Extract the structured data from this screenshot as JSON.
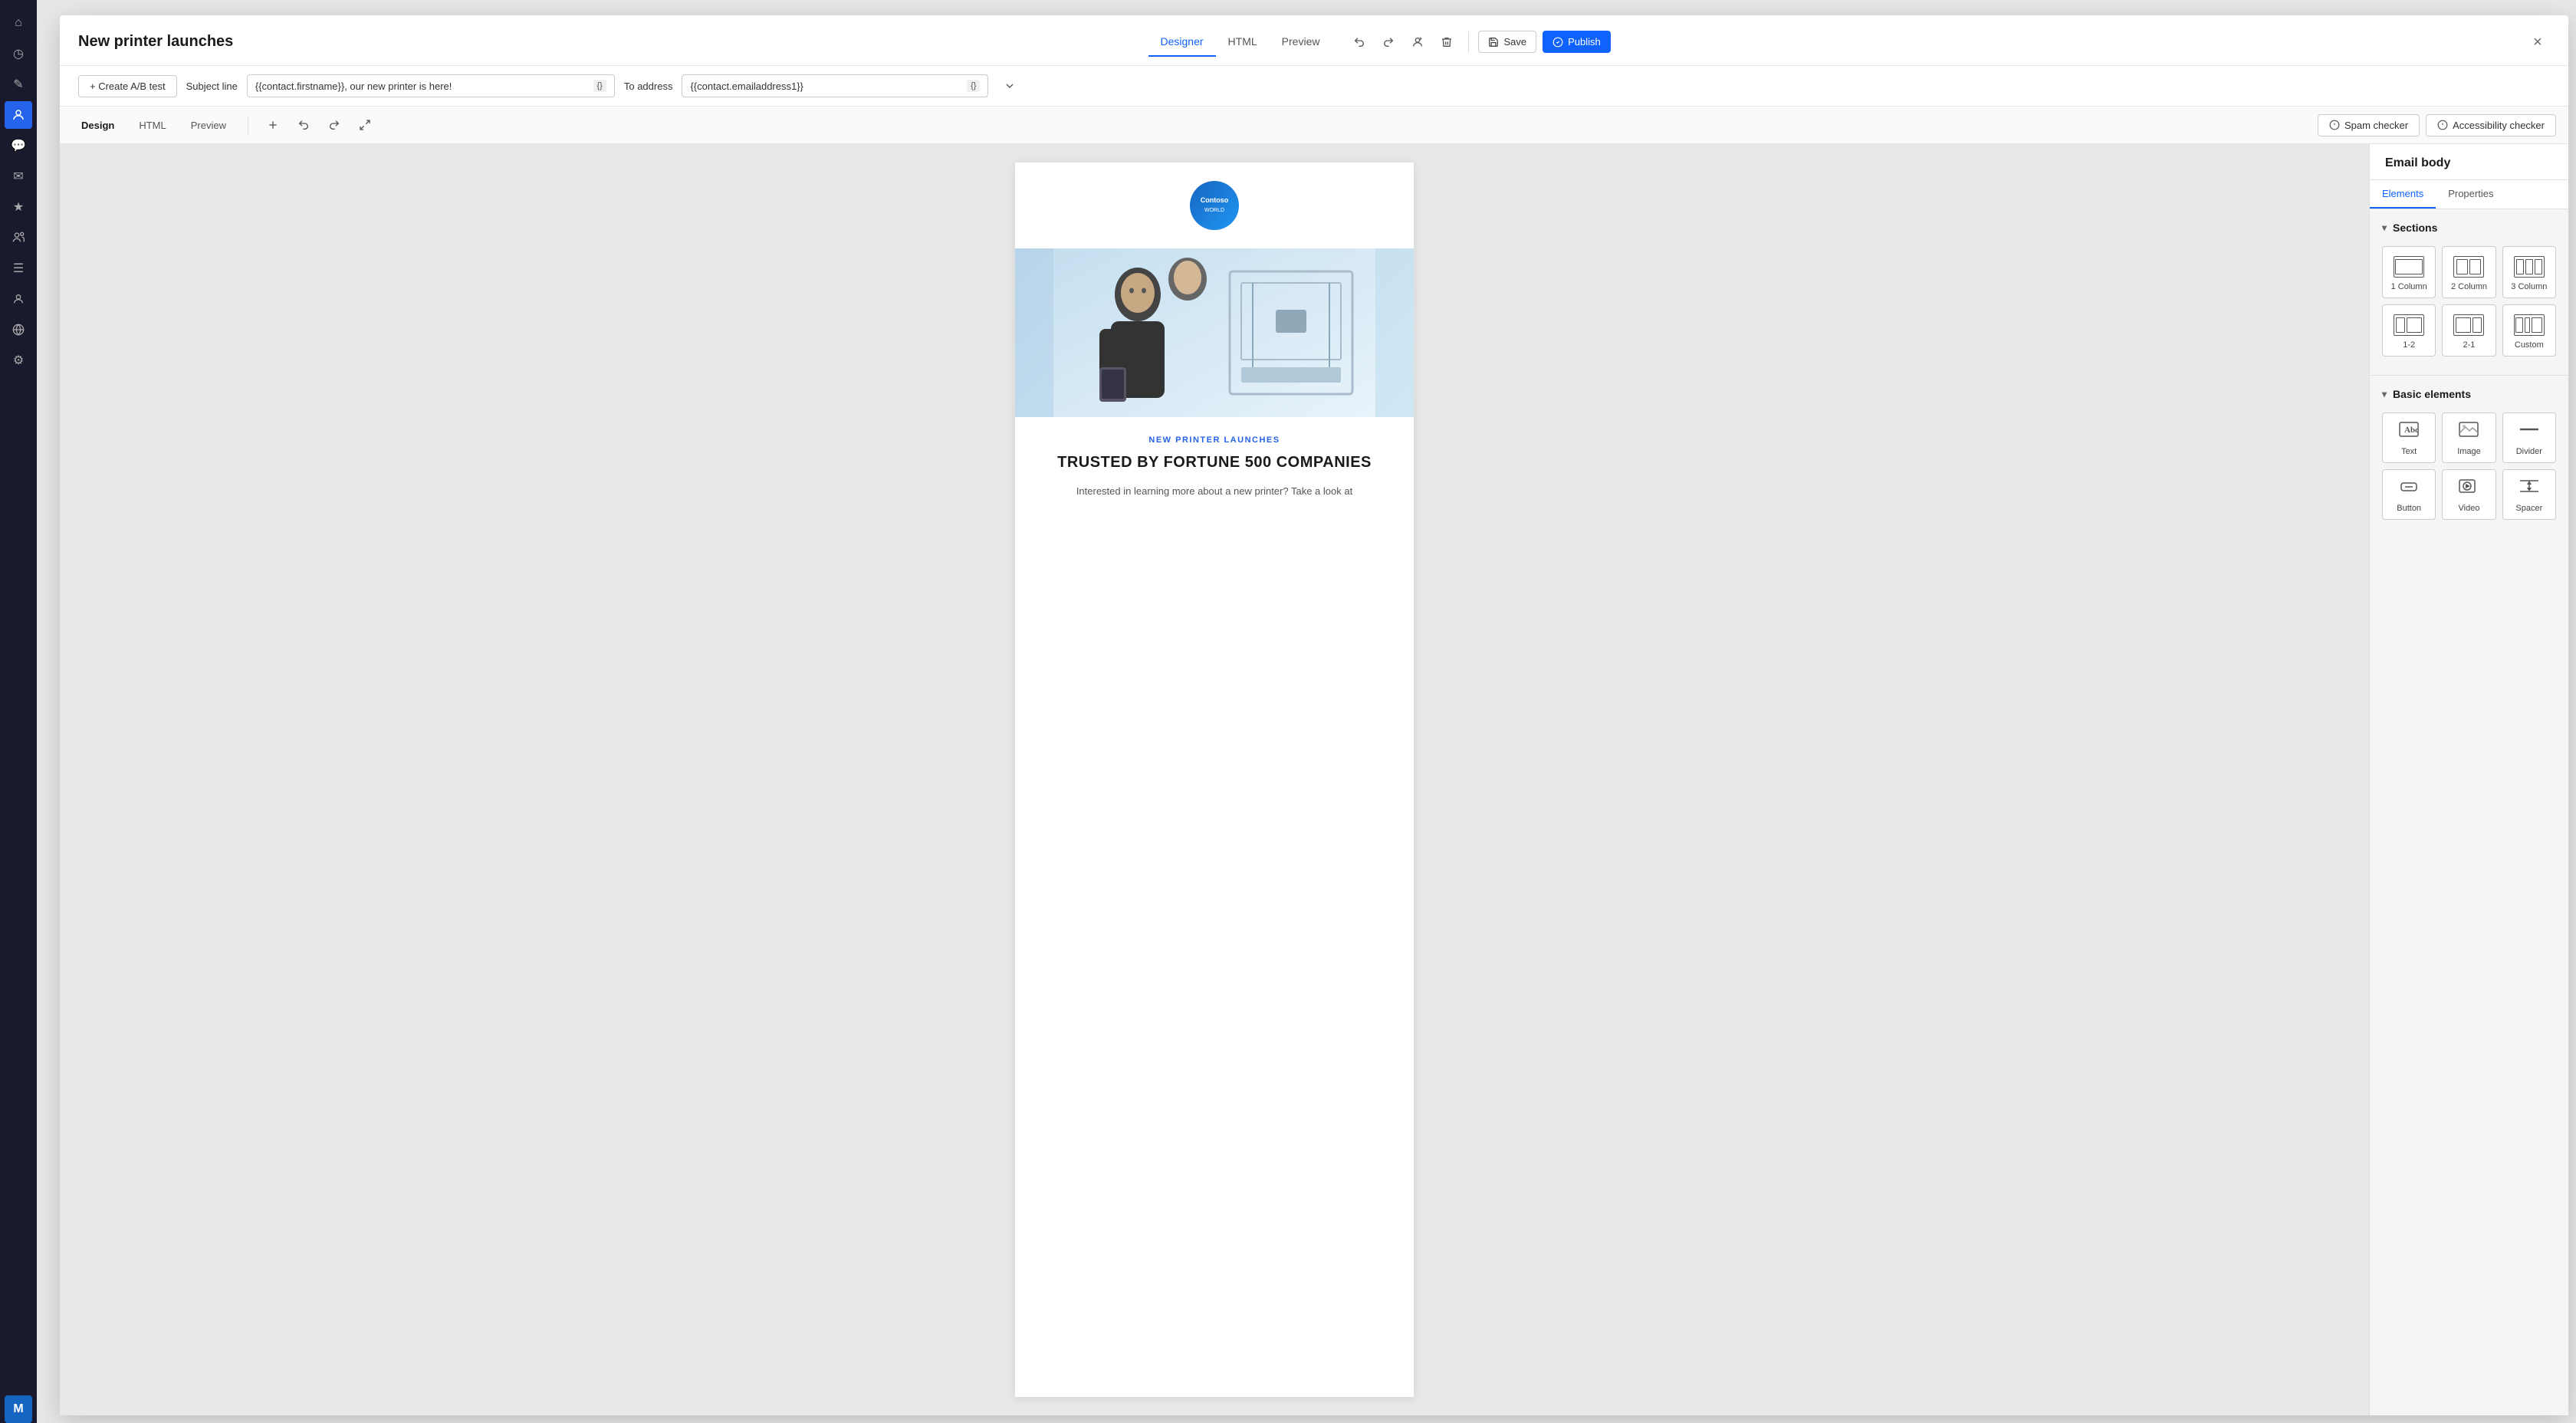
{
  "app": {
    "title": "New printer launches",
    "close_label": "×"
  },
  "header_tabs": {
    "items": [
      {
        "id": "designer",
        "label": "Designer",
        "active": true
      },
      {
        "id": "html",
        "label": "HTML",
        "active": false
      },
      {
        "id": "preview",
        "label": "Preview",
        "active": false
      }
    ]
  },
  "toolbar": {
    "save_label": "Save",
    "publish_label": "Publish"
  },
  "subject_bar": {
    "create_ab_label": "+ Create A/B test",
    "subject_line_label": "Subject line",
    "subject_value": "{{contact.firstname}}, our new printer is here!",
    "template_tag": "{}",
    "to_address_label": "To address",
    "to_address_value": "{{contact.emailaddress1}}",
    "to_address_tag": "{}"
  },
  "design_toolbar": {
    "tabs": [
      {
        "id": "design",
        "label": "Design",
        "active": true
      },
      {
        "id": "html",
        "label": "HTML",
        "active": false
      },
      {
        "id": "preview",
        "label": "Preview",
        "active": false
      }
    ],
    "spam_checker_label": "Spam checker",
    "accessibility_checker_label": "Accessibility checker"
  },
  "email_content": {
    "logo_text": "Contoso",
    "badge": "NEW PRINTER LAUNCHES",
    "headline": "TRUSTED BY FORTUNE 500 COMPANIES",
    "body_text": "Interested in learning more about a new printer? Take a look at"
  },
  "right_panel": {
    "title": "Email body",
    "tabs": [
      {
        "id": "elements",
        "label": "Elements",
        "active": true
      },
      {
        "id": "properties",
        "label": "Properties",
        "active": false
      }
    ],
    "sections": {
      "header": "Sections",
      "items": [
        {
          "id": "1col",
          "label": "1 Column"
        },
        {
          "id": "2col",
          "label": "2 Column"
        },
        {
          "id": "3col",
          "label": "3 Column"
        },
        {
          "id": "1-2",
          "label": "1-2"
        },
        {
          "id": "2-1",
          "label": "2-1"
        },
        {
          "id": "custom",
          "label": "Custom"
        }
      ]
    },
    "basic_elements": {
      "header": "Basic elements",
      "items": [
        {
          "id": "text",
          "label": "Text"
        },
        {
          "id": "image",
          "label": "Image"
        },
        {
          "id": "divider",
          "label": "Divider"
        },
        {
          "id": "button",
          "label": "Button"
        },
        {
          "id": "video",
          "label": "Video"
        },
        {
          "id": "spacer",
          "label": "Spacer"
        }
      ]
    }
  },
  "sidebar": {
    "icons": [
      {
        "id": "home",
        "symbol": "⌂",
        "active": false
      },
      {
        "id": "clock",
        "symbol": "◷",
        "active": false
      },
      {
        "id": "pencil",
        "symbol": "✎",
        "active": false
      },
      {
        "id": "contacts",
        "symbol": "👤",
        "active": true
      },
      {
        "id": "chat",
        "symbol": "💬",
        "active": false
      },
      {
        "id": "email",
        "symbol": "✉",
        "active": false
      },
      {
        "id": "star",
        "symbol": "★",
        "active": false
      },
      {
        "id": "users",
        "symbol": "👥",
        "active": false
      },
      {
        "id": "list",
        "symbol": "☰",
        "active": false
      },
      {
        "id": "globe",
        "symbol": "🌐",
        "active": false
      },
      {
        "id": "settings",
        "symbol": "⚙",
        "active": false
      }
    ]
  }
}
